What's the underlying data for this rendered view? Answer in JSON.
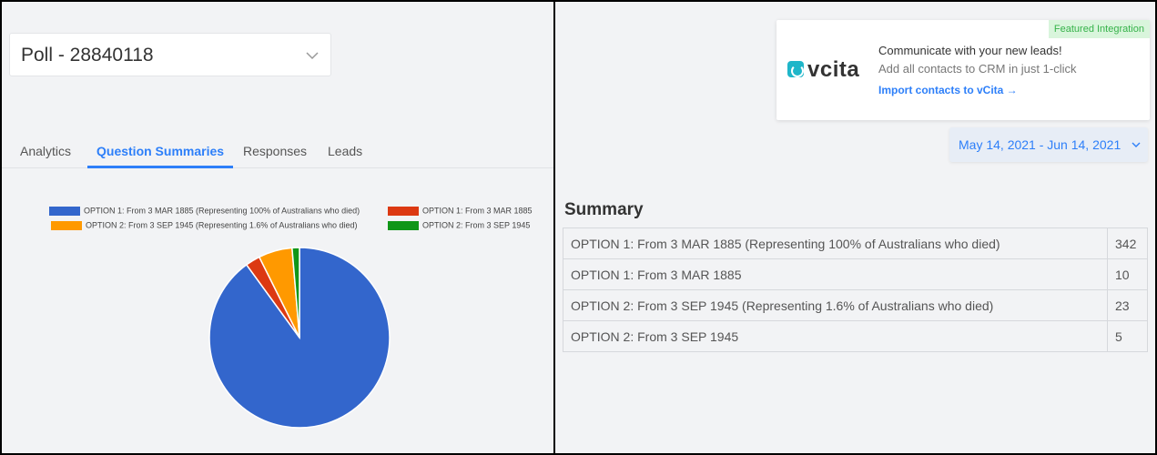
{
  "poll_selector": {
    "label": "Poll - 28840118"
  },
  "tabs": [
    {
      "label": "Analytics",
      "active": false
    },
    {
      "label": "Question Summaries",
      "active": true
    },
    {
      "label": "Responses",
      "active": false
    },
    {
      "label": "Leads",
      "active": false
    }
  ],
  "integration_card": {
    "badge": "Featured Integration",
    "logo_text": "vcita",
    "headline": "Communicate with your new leads!",
    "subtext": "Add all contacts to CRM in just 1-click",
    "link": "Import contacts to vCita →"
  },
  "date_range": {
    "label": "May 14, 2021 - Jun 14, 2021"
  },
  "summary": {
    "title": "Summary",
    "rows": [
      {
        "option": "OPTION 1: From 3 MAR 1885 (Representing 100% of Australians who died)",
        "count": "342"
      },
      {
        "option": "OPTION 1: From 3 MAR 1885",
        "count": "10"
      },
      {
        "option": "OPTION 2: From 3 SEP 1945 (Representing 1.6% of Australians who died)",
        "count": "23"
      },
      {
        "option": "OPTION 2: From 3 SEP 1945",
        "count": "5"
      }
    ]
  },
  "colors": {
    "accent": "#2d7ff9",
    "featured_badge_bg": "#d9f5dc",
    "featured_badge_text": "#36b24a"
  },
  "chart_data": {
    "type": "pie",
    "title": "",
    "legend_position": "top",
    "slices": [
      {
        "label": "OPTION 1: From 3 MAR 1885 (Representing 100% of Australians who died)",
        "value": 342,
        "color": "#3366cc"
      },
      {
        "label": "OPTION 1: From 3 MAR 1885",
        "value": 10,
        "color": "#dc3912"
      },
      {
        "label": "OPTION 2: From 3 SEP 1945 (Representing 1.6% of Australians  who died)",
        "value": 23,
        "color": "#ff9900"
      },
      {
        "label": "OPTION 2: From 3 SEP 1945",
        "value": 5,
        "color": "#109618"
      }
    ]
  }
}
